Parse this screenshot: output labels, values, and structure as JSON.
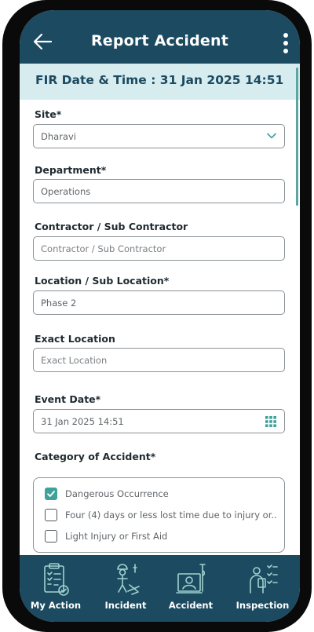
{
  "header": {
    "title": "Report Accident",
    "back_icon": "arrow-left-icon",
    "menu_icon": "more-vertical-icon"
  },
  "fir": {
    "text": "FIR Date & Time : 31 Jan 2025 14:51"
  },
  "form": {
    "site": {
      "label": "Site*",
      "value": "Dharavi",
      "icon": "chevron-down-icon"
    },
    "department": {
      "label": "Department*",
      "value": "Operations"
    },
    "contractor": {
      "label": "Contractor / Sub Contractor",
      "placeholder": "Contractor / Sub Contractor"
    },
    "location": {
      "label": "Location / Sub Location*",
      "value": "Phase 2"
    },
    "exact_location": {
      "label": "Exact Location",
      "placeholder": "Exact Location"
    },
    "event_date": {
      "label": "Event Date*",
      "value": "31 Jan 2025 14:51",
      "icon": "calendar-grid-icon"
    },
    "category": {
      "label": "Category of Accident*",
      "options": [
        {
          "label": "Dangerous Occurrence",
          "checked": true
        },
        {
          "label": "Four (4) days or less lost time due to injury or...",
          "checked": false
        },
        {
          "label": "Light Injury or First Aid",
          "checked": false
        }
      ]
    }
  },
  "nav": {
    "items": [
      {
        "label": "My Action",
        "icon": "clipboard-check-icon"
      },
      {
        "label": "Incident",
        "icon": "worker-incident-icon"
      },
      {
        "label": "Accident",
        "icon": "accident-bed-icon"
      },
      {
        "label": "Inspection",
        "icon": "inspector-checklist-icon"
      }
    ]
  },
  "colors": {
    "header": "#1c4a60",
    "fir_bar": "#d7ecef",
    "accent": "#3fa29a",
    "border": "#8b9297"
  }
}
